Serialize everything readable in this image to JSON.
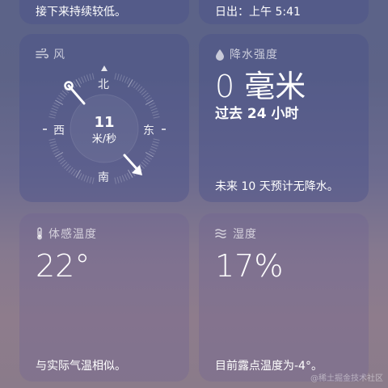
{
  "top_cards": {
    "left_text": "接下来持续较低。",
    "right_text": "日出：上午 5:41"
  },
  "wind": {
    "title": "风",
    "icon": "wind-icon",
    "speed": "11",
    "unit": "米/秒",
    "directions": {
      "north": "北",
      "east": "东",
      "south": "南",
      "west": "西"
    }
  },
  "precipitation": {
    "title": "降水强度",
    "icon": "raindrop-icon",
    "value": "0 毫米",
    "period": "过去 24 小时",
    "forecast": "未来 10 天预计无降水。"
  },
  "feels_like": {
    "title": "体感温度",
    "icon": "thermometer-icon",
    "value": "22°",
    "description": "与实际气温相似。"
  },
  "humidity": {
    "title": "湿度",
    "icon": "humidity-icon",
    "value": "17%",
    "description": "目前露点温度为-4°。"
  },
  "watermark": "@稀土掘金技术社区"
}
